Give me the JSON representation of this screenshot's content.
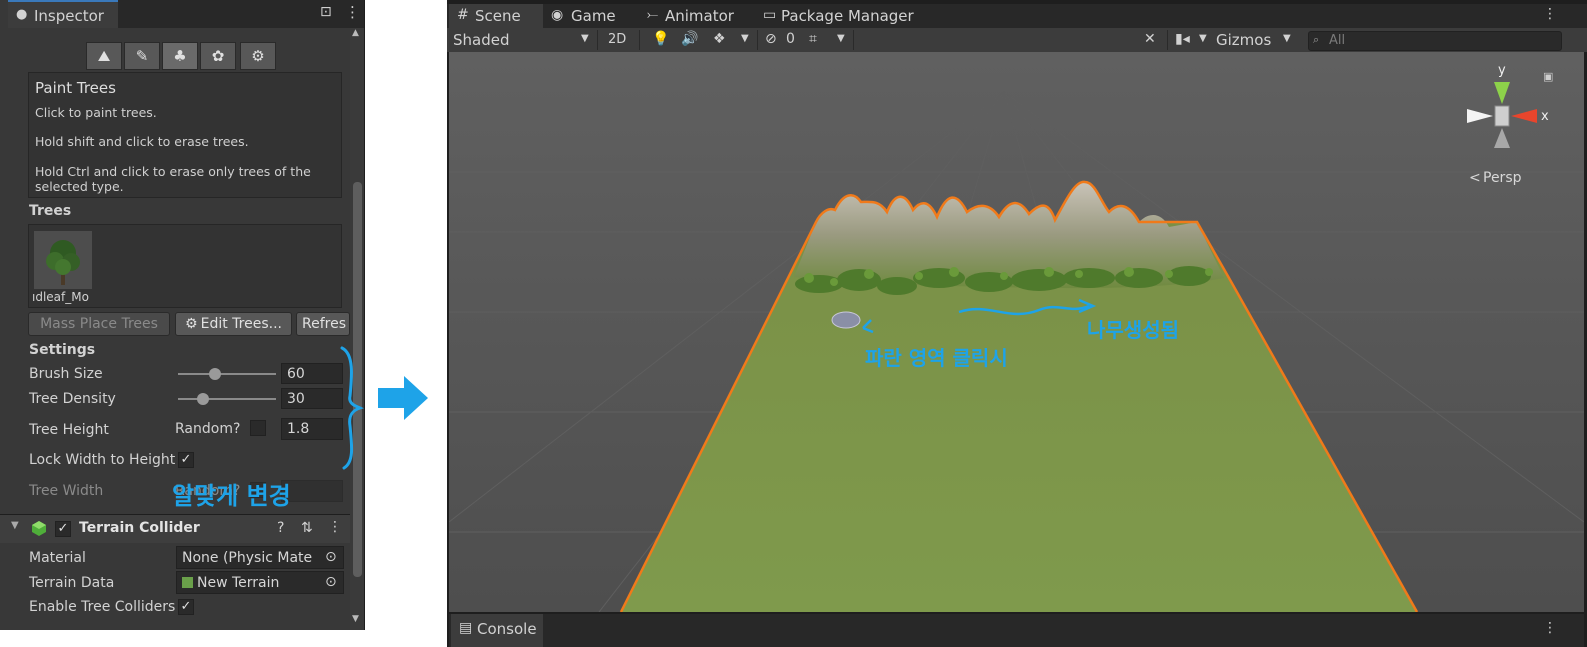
{
  "inspector": {
    "tab_label": "Inspector",
    "component_name": "Terrain",
    "help_title": "Paint Trees",
    "help_lines": [
      "Click to paint trees.",
      "Hold shift and click to erase trees.",
      "Hold Ctrl and click to erase only trees of the",
      "selected type."
    ],
    "trees_label": "Trees",
    "tree_item_name": "ıdleaf_Mo",
    "buttons": {
      "mass_place": "Mass Place Trees",
      "edit_trees": "Edit Trees...",
      "refresh": "Refres"
    },
    "settings_label": "Settings",
    "settings": {
      "brush_size_label": "Brush Size",
      "brush_size_value": "60",
      "brush_size_slider": 0.38,
      "tree_density_label": "Tree Density",
      "tree_density_value": "30",
      "tree_density_slider": 0.25,
      "tree_height_label": "Tree Height",
      "random_label": "Random?",
      "tree_height_value": "1.8",
      "lock_width_label": "Lock Width to Height",
      "lock_width_checked": "✓",
      "tree_width_label": "Tree Width",
      "tree_width_random": "Random?"
    },
    "collider": {
      "title": "Terrain Collider",
      "checked": "✓",
      "material_label": "Material",
      "material_value": "None (Physic Mate",
      "terrain_data_label": "Terrain Data",
      "terrain_data_value": "New Terrain",
      "enable_colliders_label": "Enable Tree Colliders",
      "enable_colliders_checked": "✓"
    }
  },
  "scene": {
    "tabs": [
      "Scene",
      "Game",
      "Animator",
      "Package Manager"
    ],
    "shading_mode": "Shaded",
    "mode_2d": "2D",
    "hidden_count": "0",
    "gizmos_label": "Gizmos",
    "search_placeholder": "All",
    "gizmo_axes": {
      "y": "y",
      "x": "x"
    },
    "persp_label": "Persp",
    "console_tab": "Console"
  },
  "annotations": {
    "panel_note": "알맞게 변경",
    "click_note": "파란 영역 클릭시",
    "grow_note": "나무생성됨"
  },
  "colors": {
    "accent_blue": "#1ea3e8",
    "terrain_outline": "#f07a1a",
    "terrain_green": "#7f9a4c"
  }
}
